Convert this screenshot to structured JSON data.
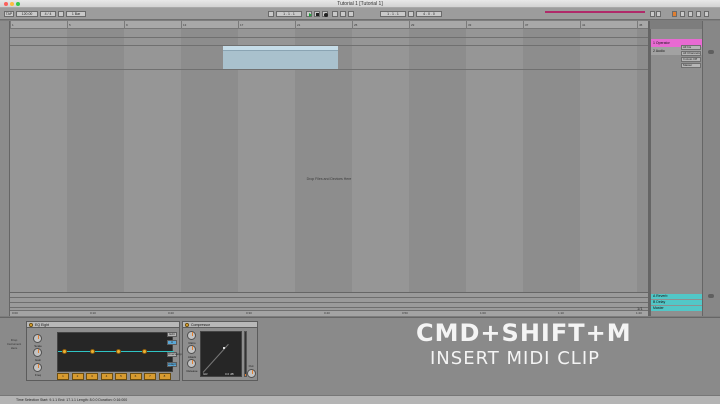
{
  "window": {
    "title": "Tutorial 1  [Tutorial 1]"
  },
  "transport": {
    "tempo": "120.00",
    "signature": "4 / 4",
    "quantize": "1 Bar",
    "position": "1 . 1 . 1",
    "loop_start": "1 . 1 . 1",
    "loop_length": "4 . 0 . 0",
    "key_label": "KEY",
    "midi_label": "MIDI"
  },
  "arrangement": {
    "ruler_labels": [
      "1",
      "5",
      "9",
      "13",
      "17",
      "21",
      "25",
      "29",
      "33",
      "37",
      "41",
      "45"
    ],
    "drop_hint": "Drop Files and Devices Here",
    "bottom_ruler_labels": [
      "0:00",
      "0:10",
      "0:20",
      "0:30",
      "0:40",
      "0:50",
      "1:00",
      "1:10",
      "1:20"
    ],
    "zoom_label": "1/1"
  },
  "mixer": {
    "tracks": [
      {
        "name": "1 Operator",
        "color": "#e86ad2"
      },
      {
        "name": "2 Audio",
        "color": "#9c9c9c"
      }
    ],
    "io": [
      "All Ins",
      "All Channels",
      "In  Auto  Off",
      "Master"
    ],
    "returns": [
      {
        "name": "A Reverb",
        "color": "#52c7c7"
      },
      {
        "name": "B Delay",
        "color": "#52c7c7"
      },
      {
        "name": "Master",
        "color": "#52c7c7"
      }
    ]
  },
  "devices": {
    "drop_hint": "Drop Instrument Here",
    "eq": {
      "title": "EQ Eight",
      "knobs": [
        "Scale",
        "Gain",
        "Freq",
        "Gain",
        "Q"
      ],
      "bands": [
        "1",
        "2",
        "3",
        "4",
        "5",
        "6",
        "7",
        "8"
      ],
      "side_buttons": [
        "Edit",
        "A",
        "Oversampling",
        "Adapt. Q"
      ]
    },
    "compressor": {
      "title": "Compressor",
      "knobs": [
        "Ratio",
        "Attack",
        "Release",
        "Out"
      ],
      "readout_left": "GR",
      "readout_right": "0.0 dB"
    }
  },
  "caption": {
    "main": "CMD+SHIFT+M",
    "sub": "INSERT MIDI CLIP"
  },
  "status": {
    "text": "Time Selection   Start: 9.1.1   End: 17.1.1   Length: 8.0.0   Duration: 0:16:000"
  },
  "colors": {
    "loop_region": "#a9c1cd",
    "accent_orange": "#e07e30",
    "cpu_bar": "#b02a69"
  }
}
